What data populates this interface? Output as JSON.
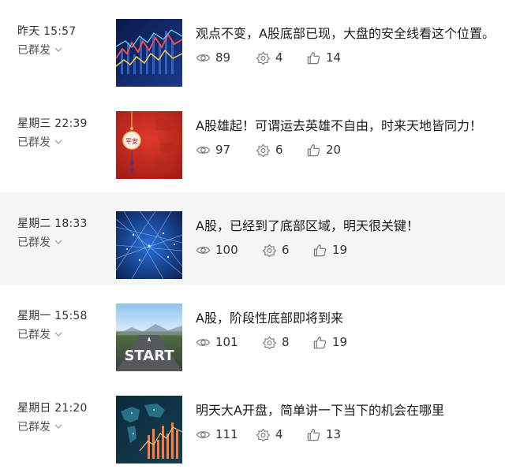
{
  "articles": [
    {
      "time": "昨天 15:57",
      "status": "已群发",
      "title": "观点不变，A股底部已现，大盘的安全线看这个位置。",
      "views": "89",
      "shares": "4",
      "likes": "14",
      "thumb": "stock-chart-thumbnail"
    },
    {
      "time": "星期三 22:39",
      "status": "已群发",
      "title": "A股雄起！可谓运去英雄不自由，时来天地皆同力！",
      "views": "97",
      "shares": "6",
      "likes": "20",
      "thumb": "red-lantern-thumbnail",
      "thumb_text": "平安"
    },
    {
      "time": "星期二 18:33",
      "status": "已群发",
      "title": "A股，已经到了底部区域，明天很关键！",
      "views": "100",
      "shares": "6",
      "likes": "19",
      "thumb": "network-lines-thumbnail"
    },
    {
      "time": "星期一 15:58",
      "status": "已群发",
      "title": "A股，阶段性底部即将到来",
      "views": "101",
      "shares": "8",
      "likes": "19",
      "thumb": "start-road-thumbnail",
      "thumb_text": "START"
    },
    {
      "time": "星期日 21:20",
      "status": "已群发",
      "title": "明天大A开盘，简单讲一下当下的机会在哪里",
      "views": "111",
      "shares": "4",
      "likes": "13",
      "thumb": "world-map-chart-thumbnail"
    }
  ],
  "colors": {
    "highlight_row": "#f5f5f5",
    "icon_gray": "#7a7a7a"
  },
  "icons": {
    "views": "eye-icon",
    "shares": "share-icon",
    "likes": "thumbs-up-icon",
    "status": "chevron-down-icon"
  }
}
